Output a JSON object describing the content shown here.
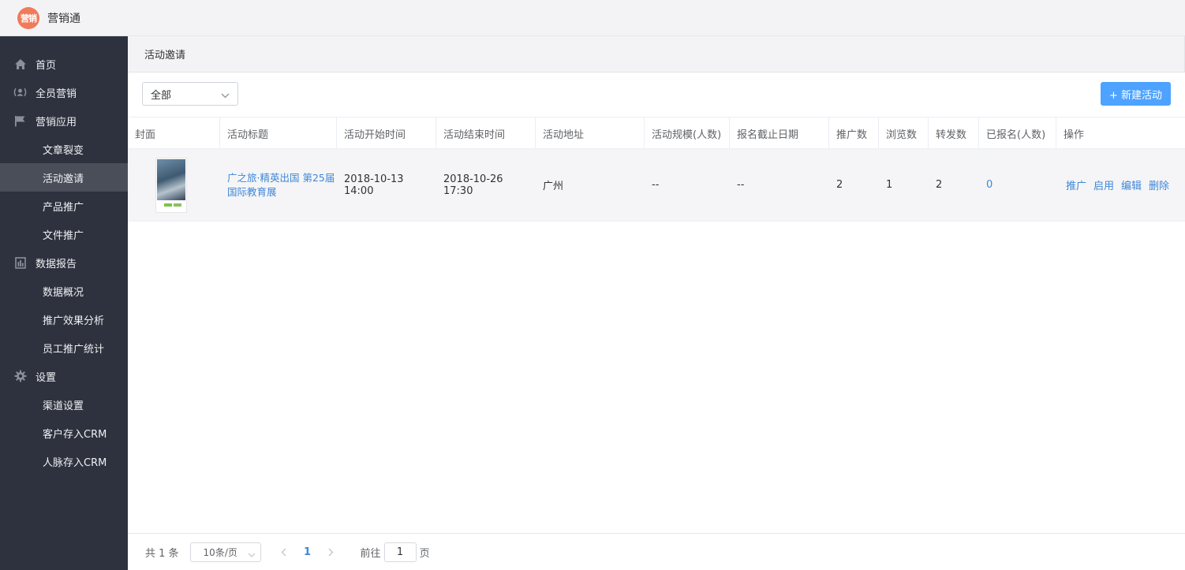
{
  "app": {
    "logo_text": "营销",
    "title": "营销通"
  },
  "sidebar": {
    "items": [
      {
        "label": "首页",
        "icon": "home-icon",
        "level": "top"
      },
      {
        "label": "全员营销",
        "icon": "broadcast-user-icon",
        "level": "top"
      },
      {
        "label": "营销应用",
        "icon": "flag-icon",
        "level": "top"
      },
      {
        "label": "文章裂变",
        "level": "sub"
      },
      {
        "label": "活动邀请",
        "level": "sub",
        "active": true
      },
      {
        "label": "产品推广",
        "level": "sub"
      },
      {
        "label": "文件推广",
        "level": "sub"
      },
      {
        "label": "数据报告",
        "icon": "report-icon",
        "level": "top"
      },
      {
        "label": "数据概况",
        "level": "sub"
      },
      {
        "label": "推广效果分析",
        "level": "sub"
      },
      {
        "label": "员工推广统计",
        "level": "sub"
      },
      {
        "label": "设置",
        "icon": "gear-icon",
        "level": "top"
      },
      {
        "label": "渠道设置",
        "level": "sub"
      },
      {
        "label": "客户存入CRM",
        "level": "sub"
      },
      {
        "label": "人脉存入CRM",
        "level": "sub"
      }
    ]
  },
  "page": {
    "title": "活动邀请"
  },
  "toolbar": {
    "filter_value": "全部",
    "new_button": "+ 新建活动"
  },
  "table": {
    "columns": [
      "封面",
      "活动标题",
      "活动开始时间",
      "活动结束时间",
      "活动地址",
      "活动规模(人数)",
      "报名截止日期",
      "推广数",
      "浏览数",
      "转发数",
      "已报名(人数)",
      "操作"
    ],
    "rows": [
      {
        "title": "广之旅·精英出国 第25届国际教育展",
        "start": "2018-10-13 14:00",
        "end": "2018-10-26 17:30",
        "address": "广州",
        "scale": "--",
        "deadline": "--",
        "promotions": "2",
        "views": "1",
        "shares": "2",
        "registered": "0",
        "actions": [
          "推广",
          "启用",
          "编辑",
          "删除"
        ]
      }
    ]
  },
  "pagination": {
    "total": "共 1 条",
    "page_size": "10条/页",
    "current_page": "1",
    "goto_label": "前往",
    "goto_value": "1",
    "goto_suffix": "页"
  },
  "colors": {
    "sidebar_bg": "#2e323e",
    "active_bg": "#4a4e59",
    "primary": "#4da3ff",
    "link": "#3d87d8",
    "logo": "#f07b5a"
  }
}
